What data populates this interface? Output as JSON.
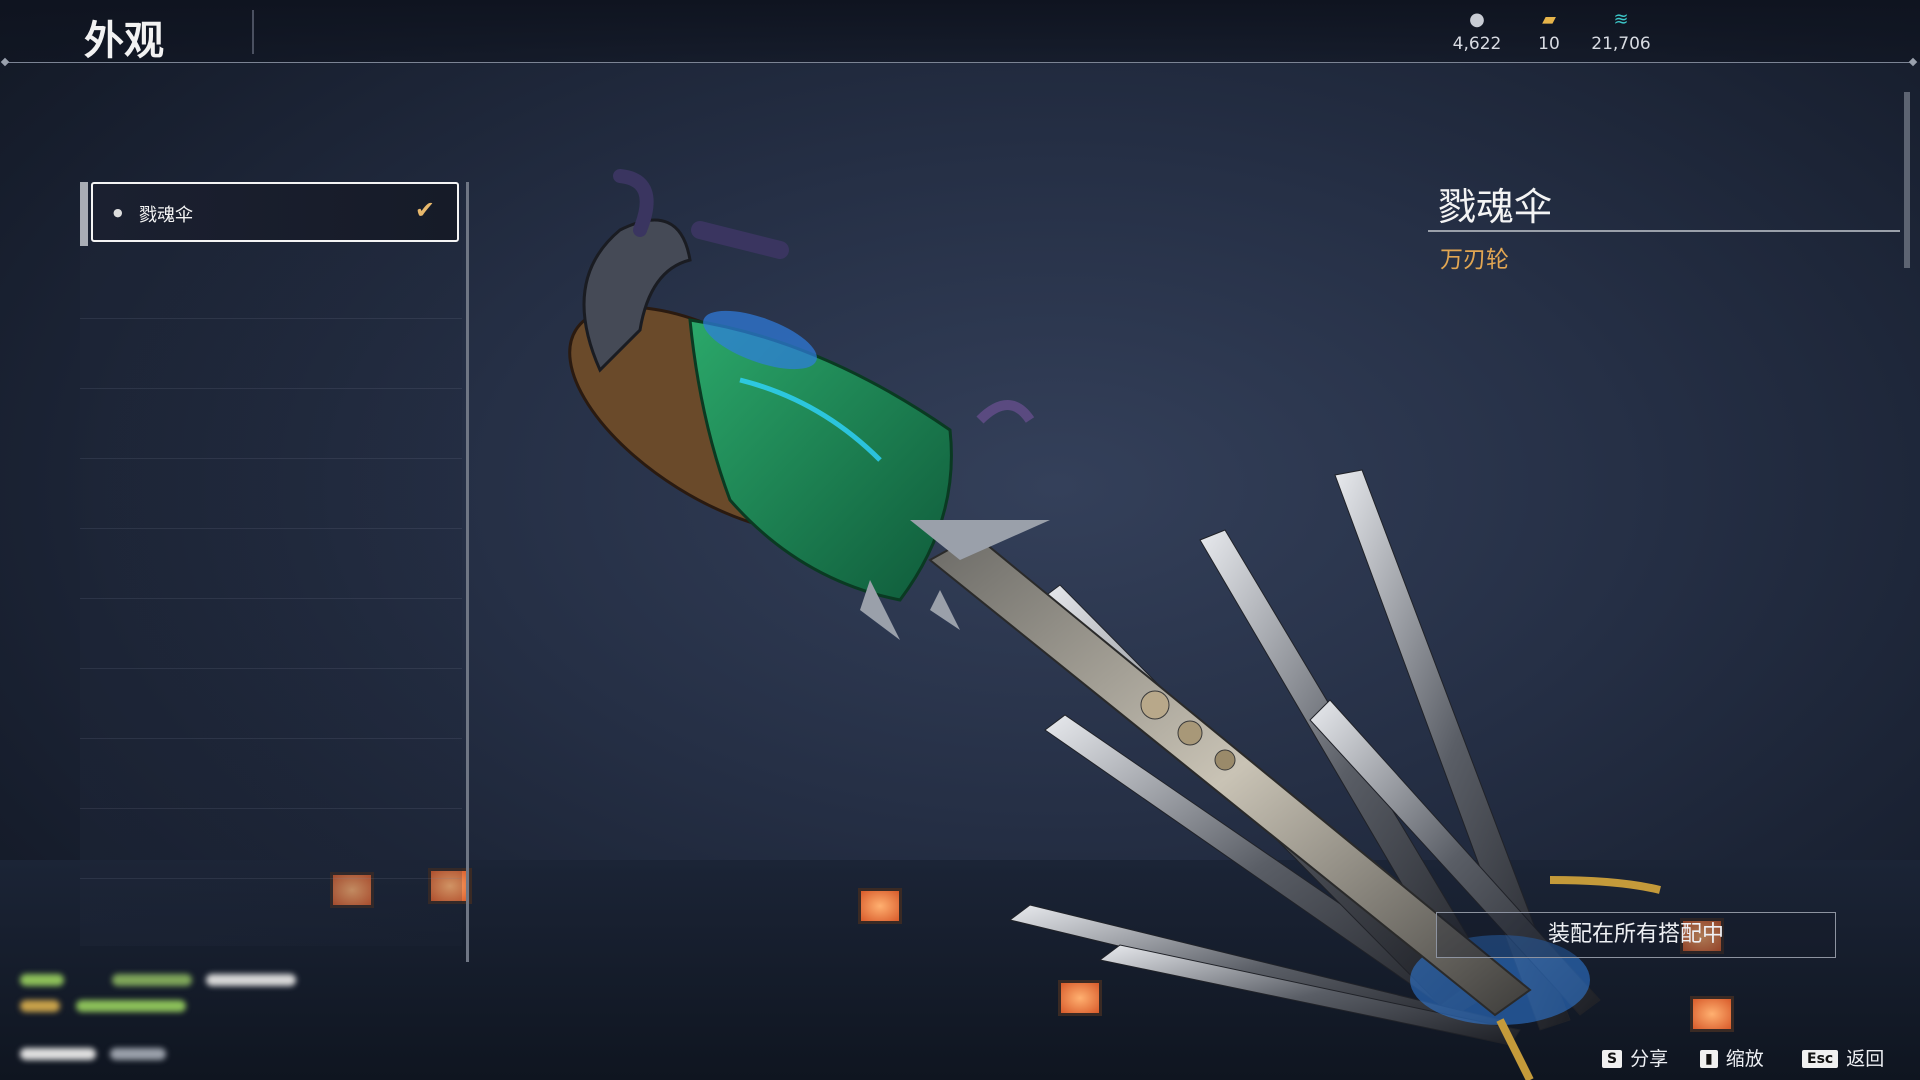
{
  "header": {
    "title": "外观",
    "currencies": [
      {
        "icon": "coin-icon",
        "value": "4,622"
      },
      {
        "icon": "chest-icon",
        "value": "10"
      },
      {
        "icon": "feather-icon",
        "value": "21,706"
      }
    ]
  },
  "list": {
    "items": [
      {
        "label": "戮魂伞",
        "selected": true
      }
    ]
  },
  "detail": {
    "name": "戮魂伞",
    "type": "万刃轮",
    "equip_button": "装配在所有搭配中"
  },
  "hints": [
    {
      "key": "S",
      "label": "分享"
    },
    {
      "key": "",
      "label": "缩放"
    },
    {
      "key": "Esc",
      "label": "返回"
    }
  ],
  "colors": {
    "accent_gold": "#e2a652",
    "check_orange": "#e7b86c",
    "weapon_green": "#1f8a5a",
    "weapon_blue": "#2f7de0"
  }
}
